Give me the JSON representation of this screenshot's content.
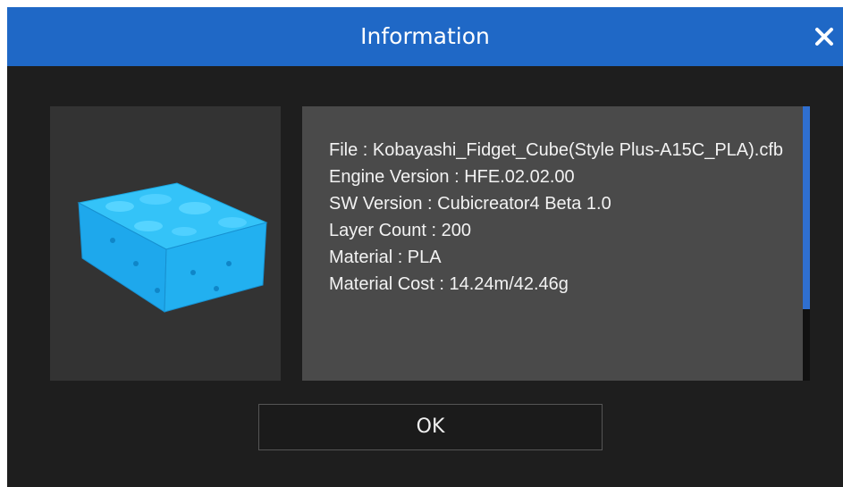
{
  "dialog": {
    "title": "Information",
    "close_icon": "close-icon",
    "colors": {
      "titlebar": "#1f68c6",
      "background": "#1e1e1e",
      "panel": "#4a4a4a",
      "model": "#29b6f6",
      "scroll_thumb": "#2f6fd0"
    }
  },
  "thumbnail": {
    "icon": "3d-model-preview"
  },
  "info": {
    "file": "File : Kobayashi_Fidget_Cube(Style Plus-A15C_PLA).cfb",
    "engine_version": "Engine Version : HFE.02.02.00",
    "sw_version": "SW Version : Cubicreator4 Beta 1.0",
    "layer_count": "Layer Count : 200",
    "material": "Material : PLA",
    "material_cost": "Material Cost : 14.24m/42.46g"
  },
  "buttons": {
    "ok_label": "OK"
  }
}
